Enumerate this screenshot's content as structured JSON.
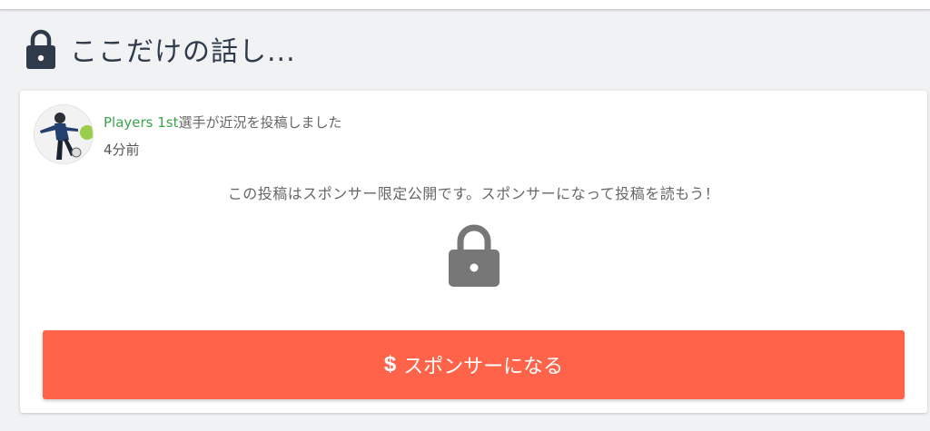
{
  "section": {
    "title": "ここだけの話し...",
    "icon": "lock-icon"
  },
  "post": {
    "player_name": "Players 1st",
    "action_text": "選手が近況を投稿しました",
    "time_ago": "4分前",
    "sponsor_only_message": "この投稿はスポンサー限定公開です。スポンサーになって投稿を読もう！"
  },
  "sponsor_button": {
    "icon": "$",
    "label": "スポンサーになる"
  },
  "colors": {
    "accent": "#ff644a",
    "player_link": "#3aa64a",
    "title_text": "#2f3a4a",
    "lock_gray": "#777777",
    "header_lock": "#2f3a4a"
  }
}
